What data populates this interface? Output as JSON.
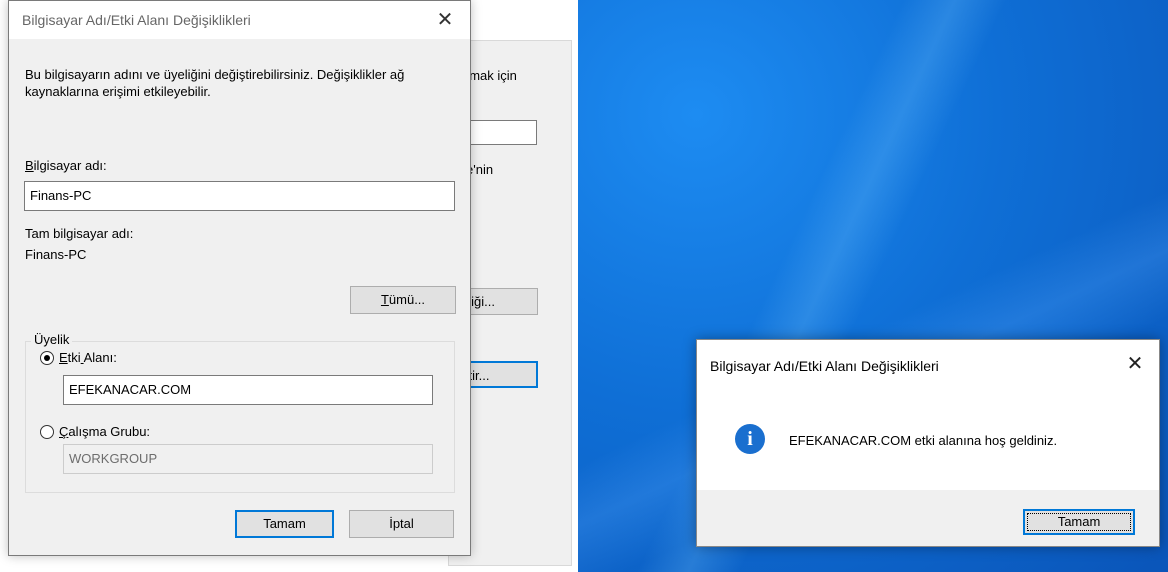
{
  "background_window": {
    "partial_texts": [
      "nmak için",
      "e'nin",
      "nliği...",
      "ştir..."
    ]
  },
  "dialog": {
    "title": "Bilgisayar Adı/Etki Alanı Değişiklikleri",
    "description": "Bu bilgisayarın adını ve üyeliğini değiştirebilirsiniz. Değişiklikler ağ kaynaklarına erişimi etkileyebilir.",
    "computer_name_label_first": "B",
    "computer_name_label_rest": "ilgisayar adı:",
    "computer_name_value": "Finans-PC",
    "full_name_label": "Tam bilgisayar adı:",
    "full_name_value": "Finans-PC",
    "more_button_first": "T",
    "more_button_rest": "ümü...",
    "membership_label": "Üyelik",
    "domain_option_first": "E",
    "domain_option_mid": "tki",
    "domain_option_under2": " ",
    "domain_option_rest": "Alanı:",
    "domain_value": "EFEKANACAR.COM",
    "workgroup_option_first": "Ç",
    "workgroup_option_rest": "alışma Grubu:",
    "workgroup_value": "WORKGROUP",
    "ok_button": "Tamam",
    "cancel_button": "İptal"
  },
  "message_box": {
    "title": "Bilgisayar Adı/Etki Alanı Değişiklikleri",
    "icon": "info-icon",
    "message": "EFEKANACAR.COM etki alanına hoş geldiniz.",
    "ok_button": "Tamam"
  },
  "colors": {
    "accent": "#0078d7",
    "desktop_blue": "#0f6fd6",
    "info_icon": "#1a6fcf"
  }
}
